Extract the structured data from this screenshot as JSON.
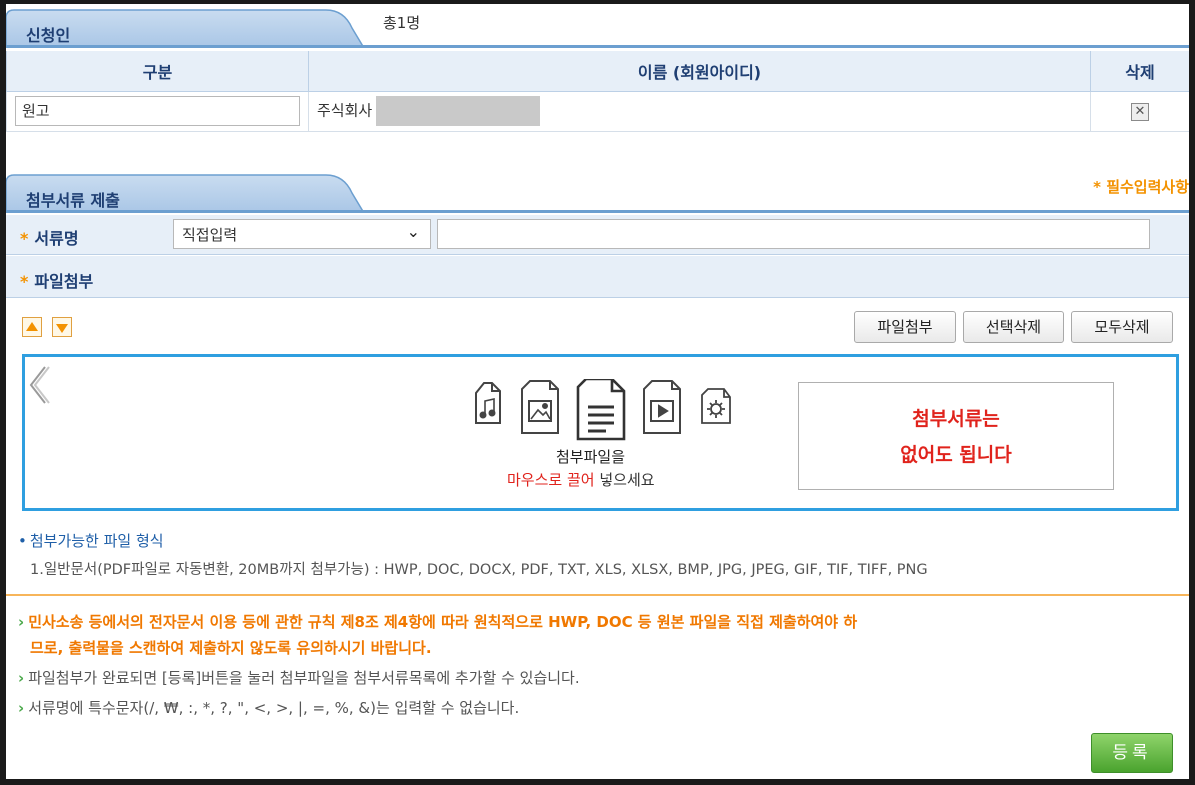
{
  "applicant_section": {
    "tab_label": "신청인",
    "total": "총1명",
    "columns": [
      "구분",
      "이름 (회원아이디)",
      "삭제"
    ],
    "rows": [
      {
        "type": "원고",
        "name": "주식회사"
      }
    ]
  },
  "attach_section": {
    "tab_label": "첨부서류 제출",
    "required_note": "* 필수입력사항",
    "doc_name_label": "서류명",
    "doc_name_select": "직접입력",
    "doc_name_input": "",
    "file_attach_label": "파일첨부",
    "buttons": {
      "attach": "파일첨부",
      "delete_selected": "선택삭제",
      "delete_all": "모두삭제"
    },
    "dropzone": {
      "line1": "첨부파일을",
      "line2_red": "마우스로 끌어",
      "line2_rest": " 넣으세요",
      "no_file_line1": "첨부서류는",
      "no_file_line2": "없어도 됩니다"
    },
    "formats_title": "첨부가능한 파일 형식",
    "formats_text": "1.일반문서(PDF파일로 자동변환, 20MB까지 첨부가능) : HWP, DOC, DOCX, PDF, TXT, XLS, XLSX, BMP, JPG, JPEG, GIF, TIF, TIFF, PNG"
  },
  "notices": {
    "warn_line1": "민사소송 등에서의 전자문서 이용 등에 관한 규칙 제8조 제4항에 따라 원칙적으로 HWP, DOC 등 원본 파일을 직접 제출하여야 하",
    "warn_line2": "므로, 출력물을 스캔하여 제출하지 않도록 유의하시기 바랍니다.",
    "info1": "파일첨부가 완료되면 [등록]버튼을 눌러 첨부파일을 첨부서류목록에 추가할 수 있습니다.",
    "info2": "서류명에 특수문자(/, ₩, :, *, ?, \", <, >, |, =, %, &)는 입력할 수 없습니다."
  },
  "register_button": "등록",
  "colors": {
    "tab_blue": "#6c9fd0",
    "header_bg": "#e7eff8",
    "accent_orange": "#f39200",
    "drop_border": "#2f9fe0",
    "red": "#e0231c",
    "green_button": "#4aa32e"
  }
}
